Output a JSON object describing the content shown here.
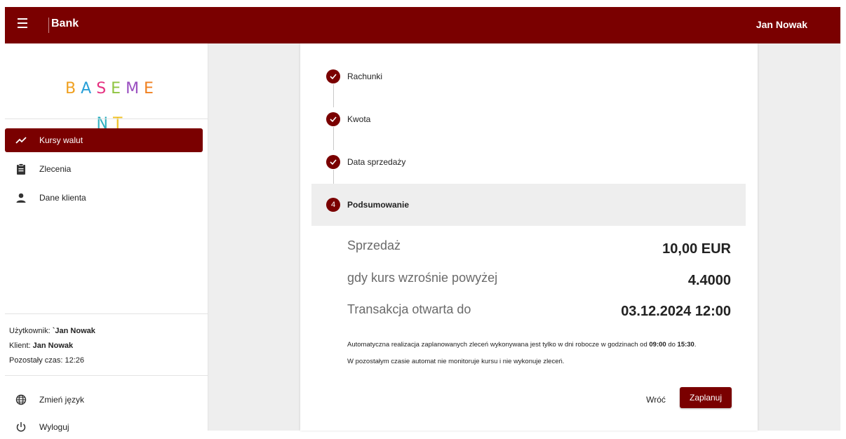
{
  "header": {
    "brand": "Bank",
    "user": "Jan Nowak",
    "color": "#7a0000"
  },
  "sidebar": {
    "logo_letters": [
      {
        "ch": "B",
        "color": "#f0a020"
      },
      {
        "ch": "A",
        "color": "#29a0d8"
      },
      {
        "ch": "S",
        "color": "#e53080"
      },
      {
        "ch": "E",
        "color": "#8fc440"
      },
      {
        "ch": "M",
        "color": "#9a4fc0"
      },
      {
        "ch": "E",
        "color": "#f08020"
      },
      {
        "ch": "N",
        "color": "#2fb0c0"
      },
      {
        "ch": "T",
        "color": "#f0c020"
      }
    ],
    "nav": [
      {
        "label": "Kursy walut",
        "icon": "trending-up-icon",
        "active": true
      },
      {
        "label": "Zlecenia",
        "icon": "clipboard-icon",
        "active": false
      },
      {
        "label": "Dane klienta",
        "icon": "person-icon",
        "active": false
      }
    ],
    "user_info": {
      "user_label": "Użytkownik:",
      "user_value": "`Jan Nowak",
      "client_label": "Klient:",
      "client_value": "Jan Nowak",
      "time_label": "Pozostały czas:",
      "time_value": "12:26"
    },
    "bottom": [
      {
        "label": "Zmień język",
        "icon": "globe-icon"
      },
      {
        "label": "Wyloguj",
        "icon": "power-icon"
      }
    ]
  },
  "stepper": {
    "steps": [
      {
        "label": "Rachunki",
        "state": "done"
      },
      {
        "label": "Kwota",
        "state": "done"
      },
      {
        "label": "Data sprzedaży",
        "state": "done"
      },
      {
        "label": "Podsumowanie",
        "state": "active",
        "number": "4"
      }
    ]
  },
  "summary": {
    "rows": [
      {
        "label": "Sprzedaż",
        "value": "10,00 EUR"
      },
      {
        "label": "gdy kurs wzrośnie powyżej",
        "value": "4.4000"
      },
      {
        "label": "Transakcja otwarta do",
        "value": "03.12.2024 12:00"
      }
    ],
    "note1_pre": "Automatyczna realizacja zaplanowanych zleceń wykonywana jest tylko w dni robocze w godzinach od ",
    "note1_from": "09:00",
    "note1_mid": " do ",
    "note1_to": "15:30",
    "note1_post": ".",
    "note2": "W pozostałym czasie automat nie monitoruje kursu i nie wykonuje zleceń."
  },
  "actions": {
    "back": "Wróć",
    "plan": "Zaplanuj"
  }
}
